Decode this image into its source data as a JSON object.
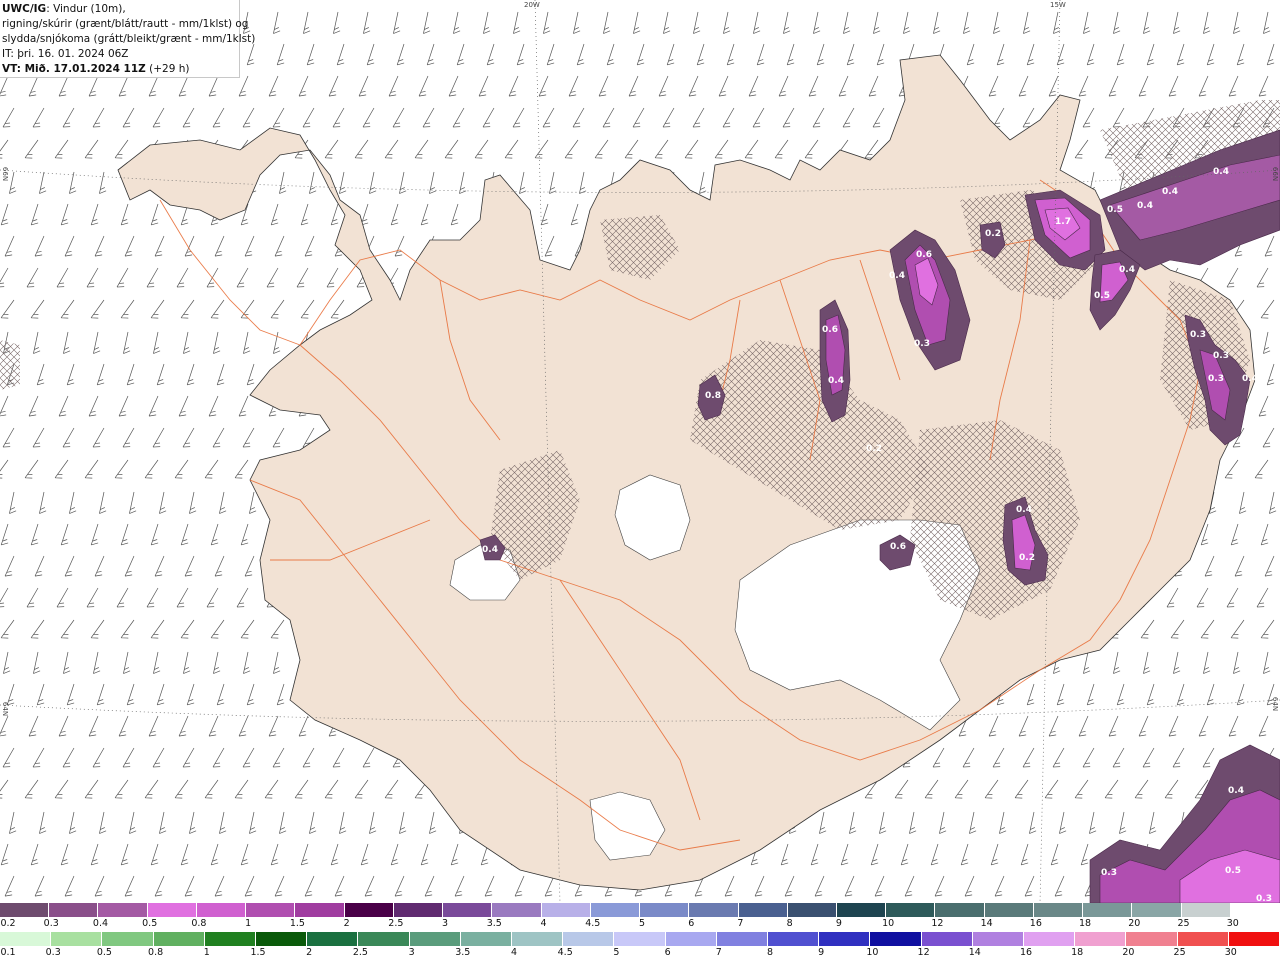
{
  "header": {
    "product": "UWC/IG",
    "line1_rest": ": Vindur (10m),",
    "line2": "rigning/skúrir (grænt/blátt/rautt - mm/1klst) og",
    "line3": "slydda/snjókoma (grátt/bleikt/grænt - mm/1klst)",
    "line4": "IT: þri. 16. 01. 2024 06Z",
    "line5_bold": "VT: Mið. 17.01.2024 11Z",
    "line5_rest": " (+29 h)"
  },
  "graticule": {
    "lon_labels": [
      "20W",
      "15W"
    ],
    "lat_labels": [
      "66N",
      "64N"
    ]
  },
  "precip_labels": [
    "1.7",
    "0.5",
    "0.4",
    "0.4",
    "0.4",
    "0.2",
    "0.6",
    "0.4",
    "0.3",
    "0.4",
    "0.5",
    "0.6",
    "0.4",
    "0.8",
    "0.3",
    "0.3",
    "0.3",
    "0.4",
    "0.2",
    "0.2",
    "0.4",
    "0.6",
    "0.4",
    "0.2",
    "0.4",
    "0.3",
    "0.5",
    "0.3"
  ],
  "legend": {
    "sleet_snow_labels": [
      "0.2",
      "0.3",
      "0.4",
      "0.5",
      "0.8",
      "1",
      "1.5",
      "2",
      "2.5",
      "3",
      "3.5",
      "4",
      "4.5",
      "5",
      "6",
      "7",
      "8",
      "9",
      "10",
      "12",
      "14",
      "16",
      "18",
      "20",
      "25",
      "30"
    ],
    "sleet_snow_colors": [
      "#6e4b6e",
      "#8a4f8a",
      "#a45aa4",
      "#e070e0",
      "#d060d0",
      "#b04eb0",
      "#a03ca0",
      "#4a0048",
      "#602a70",
      "#7a4a9a",
      "#9a7ac0",
      "#b8b0e8",
      "#8a9ad8",
      "#7a8ac8",
      "#6a7ab0",
      "#4a6090",
      "#3a5070",
      "#1e4450",
      "#2e5a5a",
      "#4a6e6e",
      "#5a7a7a",
      "#6a8888",
      "#7a9898",
      "#8aa6a6",
      "#c8d0d0",
      "#ffffff"
    ],
    "rain_labels": [
      "0.1",
      "0.3",
      "0.5",
      "0.8",
      "1",
      "1.5",
      "2",
      "2.5",
      "3",
      "3.5",
      "4",
      "4.5",
      "5",
      "6",
      "7",
      "8",
      "9",
      "10",
      "12",
      "14",
      "16",
      "18",
      "20",
      "25",
      "30"
    ],
    "rain_colors": [
      "#d8f8d8",
      "#a8e0a0",
      "#80c880",
      "#60b060",
      "#208020",
      "#0a5a0a",
      "#1a7040",
      "#3a8858",
      "#5a9c7c",
      "#7ab0a0",
      "#9ec4c4",
      "#b8c8e8",
      "#c8c8f8",
      "#a8a8f0",
      "#8080e0",
      "#5050d0",
      "#3030c0",
      "#1010a0",
      "#7a50d0",
      "#b080e0",
      "#e0a0f0",
      "#f0a0d0",
      "#f08090",
      "#f05050",
      "#f01010"
    ]
  }
}
